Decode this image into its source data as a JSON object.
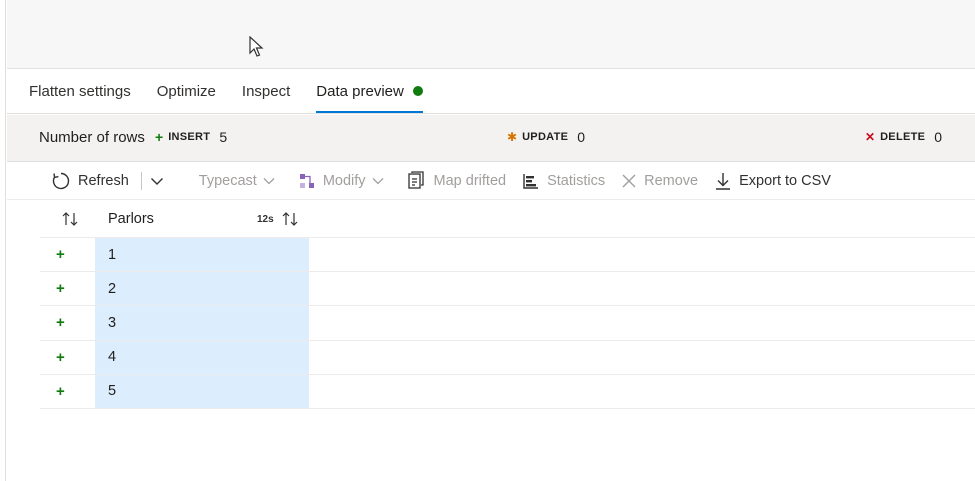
{
  "tabs": [
    {
      "label": "Flatten settings",
      "active": false
    },
    {
      "label": "Optimize",
      "active": false
    },
    {
      "label": "Inspect",
      "active": false
    },
    {
      "label": "Data preview",
      "active": true
    }
  ],
  "summary": {
    "rows_label": "Number of rows",
    "insert_label": "INSERT",
    "insert_count": "5",
    "update_label": "UPDATE",
    "update_count": "0",
    "delete_label": "DELETE",
    "delete_count": "0"
  },
  "toolbar": {
    "refresh": "Refresh",
    "typecast": "Typecast",
    "modify": "Modify",
    "map_drifted": "Map drifted",
    "statistics": "Statistics",
    "remove": "Remove",
    "export": "Export to CSV"
  },
  "grid": {
    "column": {
      "name": "Parlors",
      "type": "12s"
    },
    "rows": [
      {
        "mark": "+",
        "value": "1"
      },
      {
        "mark": "+",
        "value": "2"
      },
      {
        "mark": "+",
        "value": "3"
      },
      {
        "mark": "+",
        "value": "4"
      },
      {
        "mark": "+",
        "value": "5"
      }
    ]
  },
  "colors": {
    "accent": "#0078d4",
    "status_ok": "#107c10",
    "cell_highlight": "#dcedfd",
    "update_marker": "#d47500",
    "delete_marker": "#c50f1f"
  },
  "icons": [
    "cursor-icon",
    "status-dot",
    "plus-icon",
    "asterisk-icon",
    "x-icon",
    "refresh-icon",
    "chevron-down-icon",
    "modify-icon",
    "map-drifted-icon",
    "statistics-icon",
    "remove-icon",
    "download-icon",
    "sort-icon"
  ]
}
